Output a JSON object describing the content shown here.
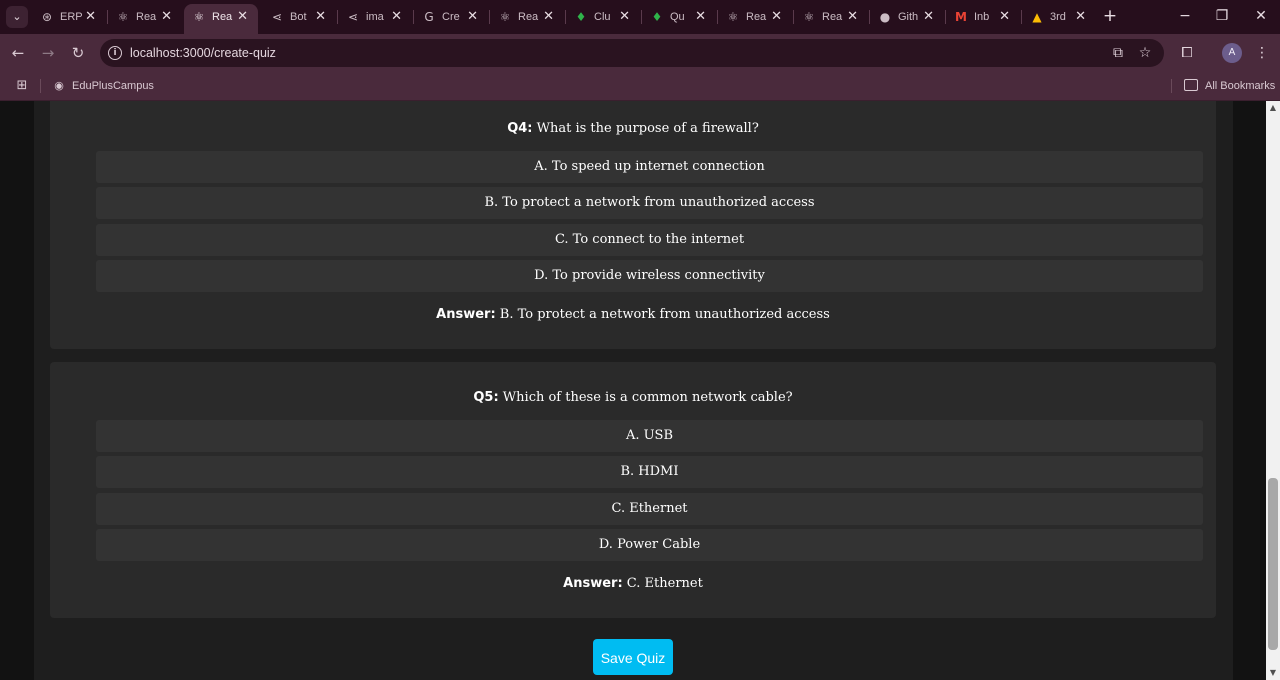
{
  "browser": {
    "tabs": [
      {
        "favicon": "⊛",
        "favicon_name": "openai-icon",
        "title": "ERP",
        "active": false
      },
      {
        "favicon": "⚛",
        "favicon_name": "react-icon",
        "title": "Rea",
        "active": false
      },
      {
        "favicon": "⚛",
        "favicon_name": "react-icon",
        "title": "Rea",
        "active": true
      },
      {
        "favicon": "⋖",
        "favicon_name": "share-icon",
        "title": "Bot",
        "active": false
      },
      {
        "favicon": "⋖",
        "favicon_name": "share-icon",
        "title": "ima",
        "active": false
      },
      {
        "favicon": "G",
        "favicon_name": "google-icon",
        "title": "Cre",
        "active": false
      },
      {
        "favicon": "⚛",
        "favicon_name": "react-icon",
        "title": "Rea",
        "active": false
      },
      {
        "favicon": "♦",
        "favicon_name": "leaf-icon",
        "title": "Clu",
        "active": false
      },
      {
        "favicon": "♦",
        "favicon_name": "leaf-icon",
        "title": "Qu",
        "active": false
      },
      {
        "favicon": "⚛",
        "favicon_name": "react-icon",
        "title": "Rea",
        "active": false
      },
      {
        "favicon": "⚛",
        "favicon_name": "react-icon",
        "title": "Rea",
        "active": false
      },
      {
        "favicon": "●",
        "favicon_name": "github-icon",
        "title": "Gith",
        "active": false
      },
      {
        "favicon": "M",
        "favicon_name": "gmail-icon",
        "title": "Inb",
        "active": false
      },
      {
        "favicon": "▲",
        "favicon_name": "drive-icon",
        "title": "3rd",
        "active": false
      }
    ],
    "new_tab": "+",
    "url": "localhost:3000/create-quiz",
    "avatar_letter": "A",
    "bookmarks": {
      "item": "EduPlusCampus",
      "all_bookmarks": "All Bookmarks"
    }
  },
  "quiz": {
    "questions": [
      {
        "label": "Q4:",
        "text": "What is the purpose of a firewall?",
        "options": [
          "A. To speed up internet connection",
          "B. To protect a network from unauthorized access",
          "C. To connect to the internet",
          "D. To provide wireless connectivity"
        ],
        "answer_label": "Answer:",
        "answer": "B. To protect a network from unauthorized access"
      },
      {
        "label": "Q5:",
        "text": "Which of these is a common network cable?",
        "options": [
          "A. USB",
          "B. HDMI",
          "C. Ethernet",
          "D. Power Cable"
        ],
        "answer_label": "Answer:",
        "answer": "C. Ethernet"
      }
    ],
    "save_label": "Save Quiz"
  },
  "colors": {
    "accent": "#00bcf2",
    "card": "#2a2a2a",
    "option": "#333333",
    "browser_frame": "#4a2a3c"
  }
}
